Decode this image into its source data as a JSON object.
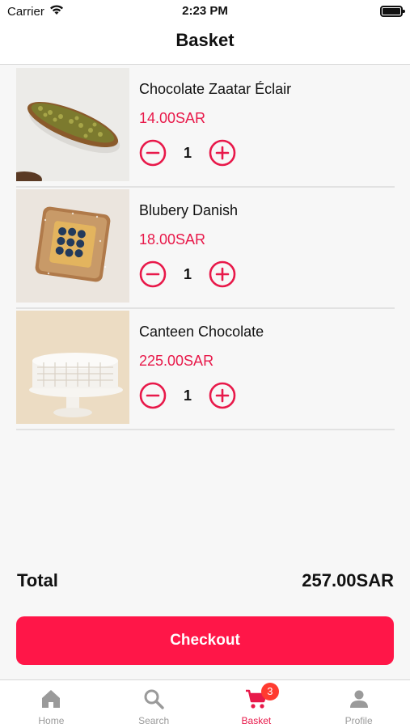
{
  "status_bar": {
    "carrier": "Carrier",
    "time": "2:23 PM"
  },
  "header": {
    "title": "Basket"
  },
  "basket": {
    "items": [
      {
        "name": "Chocolate Zaatar Éclair",
        "price": "14.00SAR",
        "quantity": "1",
        "image": "eclair-photo"
      },
      {
        "name": "Blubery Danish",
        "price": "18.00SAR",
        "quantity": "1",
        "image": "danish-photo"
      },
      {
        "name": "Canteen Chocolate",
        "price": "225.00SAR",
        "quantity": "1",
        "image": "cake-photo"
      }
    ]
  },
  "summary": {
    "total_label": "Total",
    "total_value": "257.00SAR"
  },
  "checkout": {
    "label": "Checkout"
  },
  "tab_bar": {
    "tabs": [
      {
        "label": "Home",
        "icon": "home-icon",
        "active": false
      },
      {
        "label": "Search",
        "icon": "search-icon",
        "active": false
      },
      {
        "label": "Basket",
        "icon": "cart-icon",
        "active": true,
        "badge": "3"
      },
      {
        "label": "Profile",
        "icon": "person-icon",
        "active": false
      }
    ]
  },
  "colors": {
    "accent": "#e8194a",
    "button": "#ff1648",
    "badge": "#ff3b30",
    "inactive": "#9a9a9a"
  }
}
